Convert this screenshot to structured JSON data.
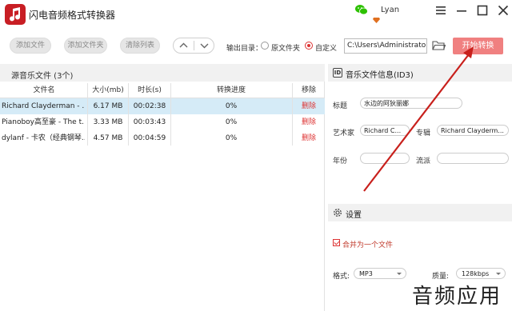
{
  "app": {
    "title": "闪电音频格式转换器",
    "user": "Lyan"
  },
  "toolbar": {
    "add_file": "添加文件",
    "add_folder": "添加文件夹",
    "clear_list": "清除列表",
    "output_label": "输出目录：",
    "radio_source": "原文件夹",
    "radio_custom": "自定义",
    "output_path": "C:\\Users\\Administrator",
    "start": "开始转换"
  },
  "file_list": {
    "title": "源音乐文件 (3个)",
    "columns": [
      "文件名",
      "大小(mb)",
      "时长(s)",
      "转换进度",
      "移除"
    ],
    "rows": [
      {
        "name": "Richard Clayderman - ...",
        "size": "6.17 MB",
        "duration": "00:02:38",
        "progress": "0%",
        "remove": "删除"
      },
      {
        "name": "Pianoboy高至豪 - The t...",
        "size": "3.33 MB",
        "duration": "00:03:43",
        "progress": "0%",
        "remove": "删除"
      },
      {
        "name": "dylanf - 卡农（经典钢琴...",
        "size": "4.57 MB",
        "duration": "00:04:59",
        "progress": "0%",
        "remove": "删除"
      }
    ]
  },
  "id3": {
    "title": "音乐文件信息(ID3)",
    "title_label": "标题",
    "title_value": "水边的阿狄丽娜",
    "artist_label": "艺术家",
    "artist_value": "Richard C...",
    "album_label": "专辑",
    "album_value": "Richard Clayderm...",
    "year_label": "年份",
    "year_value": "",
    "genre_label": "流派",
    "genre_value": ""
  },
  "settings": {
    "title": "设置",
    "merge_label": "合并为一个文件",
    "format_label": "格式:",
    "format_value": "MP3",
    "quality_label": "质量:",
    "quality_value": "128kbps"
  },
  "watermark": "音频应用",
  "colors": {
    "accent": "#d33333",
    "start_button": "#f08080",
    "selected_row": "#d5ebf7",
    "arrow": "#c8201c"
  }
}
